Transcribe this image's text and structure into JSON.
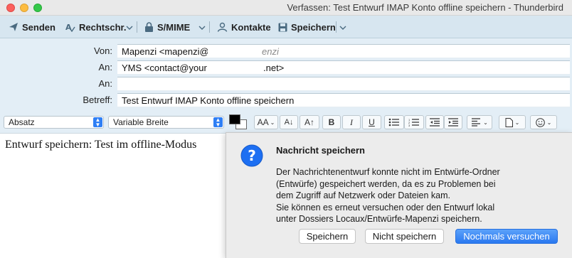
{
  "window": {
    "title": "Verfassen: Test Entwurf IMAP Konto offline speichern - Thunderbird"
  },
  "toolbar": {
    "send": "Senden",
    "spellcheck": "Rechtschr.",
    "smime": "S/MIME",
    "contacts": "Kontakte",
    "save": "Speichern"
  },
  "headers": {
    "from_label": "Von:",
    "from_value": "Mapenzi <mapenzi@",
    "from_tail": "enzi",
    "to_label": "An:",
    "to_value": "YMS <contact@your",
    "to_tail": ".net>",
    "to2_label": "An:",
    "to2_value": "",
    "subject_label": "Betreff:",
    "subject_value": "Test Entwurf IMAP Konto offline speichern"
  },
  "format": {
    "paragraph": "Absatz",
    "font": "Variable Breite",
    "smaller_font": "AA",
    "bold": "B",
    "italic": "I",
    "underline": "U"
  },
  "body": {
    "text": "Entwurf speichern: Test im offline-Modus"
  },
  "dialog": {
    "title": "Nachricht speichern",
    "lines": [
      "Der Nachrichtenentwurf konnte nicht im Entwürfe-Ordner",
      "(Entwürfe) gespeichert werden, da es zu Problemen bei",
      "dem Zugriff auf Netzwerk oder Dateien kam.",
      "Sie können es erneut versuchen oder den Entwurf lokal",
      "unter Dossiers Locaux/Entwürfe-Mapenzi speichern."
    ],
    "btn_save": "Speichern",
    "btn_dont_save": "Nicht speichern",
    "btn_retry": "Nochmals versuchen"
  },
  "colors": {
    "toolbar_bg": "#d7e6f0",
    "header_bg": "#e3eef6",
    "primary_button": "#2a79f0",
    "dialog_icon": "#1d6ff2"
  }
}
